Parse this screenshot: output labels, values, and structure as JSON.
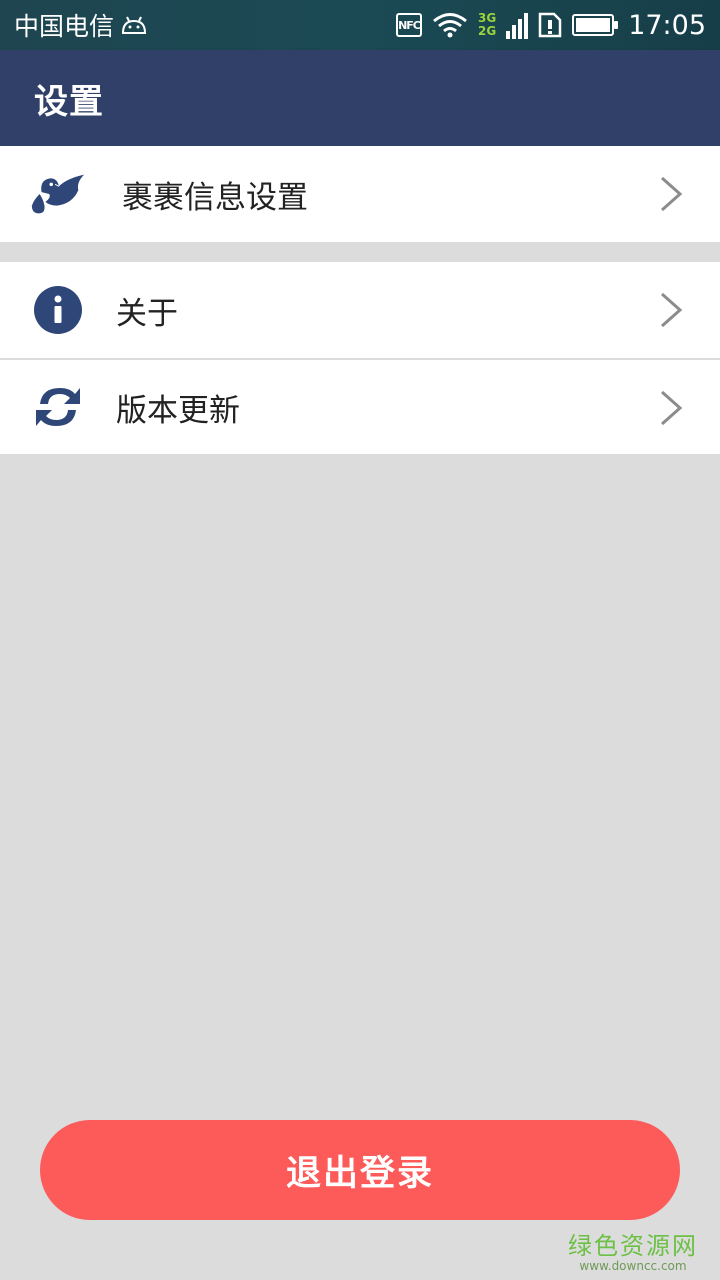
{
  "statusbar": {
    "carrier": "中国电信",
    "nfc": "NFC",
    "net_top": "3G",
    "net_bottom": "2G",
    "time": "17:05"
  },
  "appbar": {
    "title": "设置"
  },
  "menu_groups": [
    {
      "items": [
        {
          "label": "裹裹信息设置",
          "icon": "dove-icon"
        }
      ]
    },
    {
      "items": [
        {
          "label": "关于",
          "icon": "info-icon"
        },
        {
          "label": "版本更新",
          "icon": "refresh-icon"
        }
      ]
    }
  ],
  "logout": {
    "label": "退出登录"
  },
  "watermark": {
    "main": "绿色资源网",
    "sub": "www.downcc.com"
  },
  "colors": {
    "appbar": "#314069",
    "icon": "#2f4679",
    "logout": "#fd5a5a",
    "background": "#dcdcdc"
  }
}
